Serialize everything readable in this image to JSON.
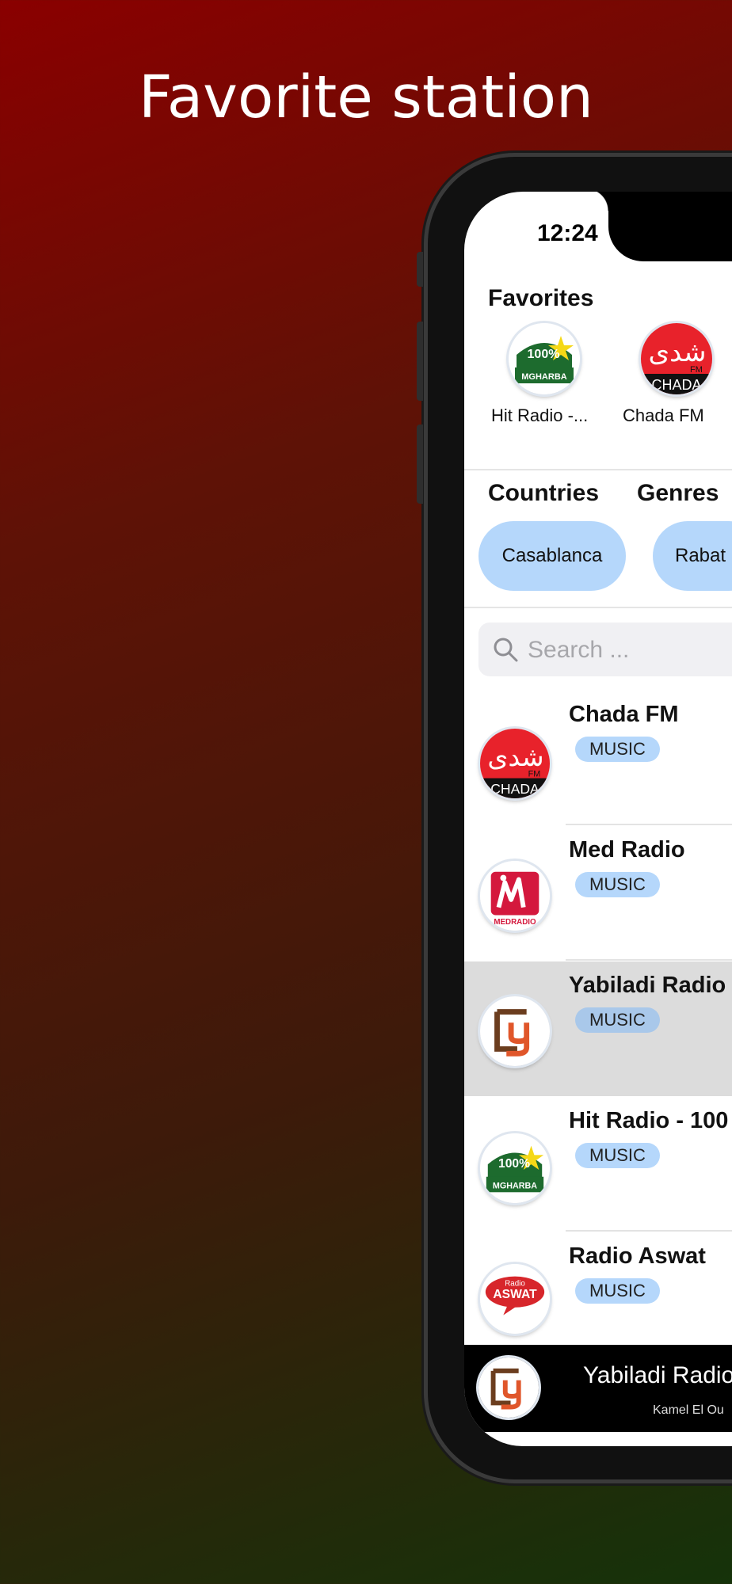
{
  "headline": "Favorite station",
  "status": {
    "time": "12:24"
  },
  "favorites": {
    "title": "Favorites",
    "items": [
      {
        "label": "Hit Radio -...",
        "logo": "hit-radio-logo"
      },
      {
        "label": "Chada FM",
        "logo": "chada-fm-logo"
      }
    ]
  },
  "sections": {
    "countries": "Countries",
    "genres": "Genres"
  },
  "chips": [
    "Casablanca",
    "Rabat"
  ],
  "search": {
    "placeholder": "Search ..."
  },
  "stations": [
    {
      "name": "Chada FM",
      "tag": "MUSIC",
      "logo": "chada-fm-logo"
    },
    {
      "name": "Med Radio",
      "tag": "MUSIC",
      "logo": "med-radio-logo"
    },
    {
      "name": "Yabiladi Radio",
      "tag": "MUSIC",
      "logo": "yabiladi-logo",
      "selected": true
    },
    {
      "name": "Hit Radio - 100",
      "tag": "MUSIC",
      "logo": "hit-radio-logo"
    },
    {
      "name": "Radio Aswat",
      "tag": "MUSIC",
      "logo": "aswat-logo"
    }
  ],
  "player": {
    "title": "Yabiladi Radio",
    "subtitle": "Kamel El Ou",
    "logo": "yabiladi-logo"
  },
  "logo_texts": {
    "hit_percent": "100%",
    "hit_name": "MGHARBA",
    "chada_name": "CHADA",
    "chada_fm": "FM",
    "chada_arabic": "شدى",
    "med_name": "MEDRADIO",
    "aswat_small": "Radio",
    "aswat_name": "ASWAT"
  },
  "colors": {
    "chip": "#b5d7fb",
    "chada_red": "#e8222b",
    "hit_green": "#1d6b2e",
    "yabiladi_brown": "#6b3d1e",
    "yabiladi_orange": "#e0562a",
    "med_red": "#d4183d",
    "aswat_red": "#d7262b"
  }
}
